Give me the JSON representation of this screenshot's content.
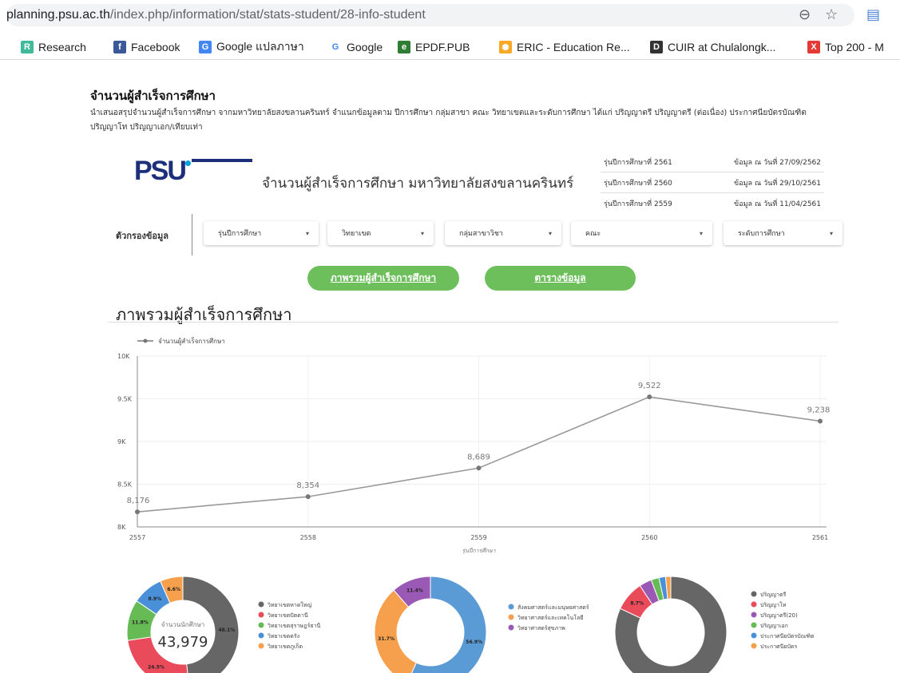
{
  "browser": {
    "url_domain": "planning.psu.ac.th",
    "url_path": "/index.php/information/stat/stats-student/28-info-student",
    "bookmarks": [
      {
        "label": "Research",
        "icon": "researchgate-icon",
        "color": "#40ba9b",
        "glyph": "R"
      },
      {
        "label": "Facebook",
        "icon": "facebook-icon",
        "color": "#3b5998",
        "glyph": "f"
      },
      {
        "label": "Google แปลภาษา",
        "icon": "google-translate-icon",
        "color": "#4285f4",
        "glyph": "G"
      },
      {
        "label": "Google",
        "icon": "google-icon",
        "color": "#ffffff",
        "glyph": "G"
      },
      {
        "label": "EPDF.PUB",
        "icon": "epdf-icon",
        "color": "#2e7d32",
        "glyph": "e"
      },
      {
        "label": "ERIC - Education Re...",
        "icon": "eric-icon",
        "color": "#f9a825",
        "glyph": "✺"
      },
      {
        "label": "CUIR at Chulalongk...",
        "icon": "cuir-icon",
        "color": "#333333",
        "glyph": "D"
      },
      {
        "label": "Top 200 - M",
        "icon": "top200-icon",
        "color": "#e53935",
        "glyph": "X"
      }
    ]
  },
  "page": {
    "title": "จำนวนผู้สำเร็จการศึกษา",
    "description": "นำเสนอสรุปจำนวนผู้สำเร็จการศึกษา จากมหาวิทยาลัยสงขลานครินทร์ จำแนกข้อมูลตาม ปีการศึกษา กลุ่มสาขา คณะ วิทยาเขตและระดับการศึกษา ได้แก่ ปริญญาตรี ปริญญาตรี (ต่อเนื่อง) ประกาศนียบัตรบัณฑิต ปริญญาโท ปริญญาเอก/เทียบเท่า"
  },
  "dashboard": {
    "logo_text": "PSU",
    "title": "จำนวนผู้สำเร็จการศึกษา มหาวิทยาลัยสงขลานครินทร์",
    "years": [
      {
        "label": "รุ่นปีการศึกษาที่ 2561",
        "date": "ข้อมูล ณ วันที่ 27/09/2562"
      },
      {
        "label": "รุ่นปีการศึกษาที่ 2560",
        "date": "ข้อมูล ณ วันที่ 29/10/2561"
      },
      {
        "label": "รุ่นปีการศึกษาที่ 2559",
        "date": "ข้อมูล ณ วันที่ 11/04/2561"
      }
    ],
    "filter_label": "ตัวกรองข้อมูล",
    "filters": [
      "รุ่นปีการศึกษา",
      "วิทยาเขต",
      "กลุ่มสาขาวิชา",
      "คณะ",
      "ระดับการศึกษา"
    ],
    "buttons": [
      "ภาพรวมผู้สำเร็จการศึกษา",
      "ตารางข้อมูล"
    ],
    "section_title": "ภาพรวมผู้สำเร็จการศึกษา",
    "line_color": "#999999",
    "accent_green": "#6dbf5c"
  },
  "chart_data": [
    {
      "type": "line",
      "legend": "จำนวนผู้สำเร็จการศึกษา",
      "xlabel": "รุ่นปีการศึกษา",
      "x": [
        "2557",
        "2558",
        "2559",
        "2560",
        "2561"
      ],
      "series": [
        {
          "name": "จำนวนผู้สำเร็จการศึกษา",
          "values": [
            8176,
            8354,
            8689,
            9522,
            9238
          ]
        }
      ],
      "data_labels": [
        "8,176",
        "8,354",
        "8,689",
        "9,522",
        "9,238"
      ],
      "ylim": [
        8000,
        10000
      ],
      "yticks": [
        "8K",
        "8.5K",
        "9K",
        "9.5K",
        "10K"
      ],
      "grid": true,
      "legend_position": "top-left"
    },
    {
      "type": "pie",
      "center_label": "จำนวนนักศึกษา",
      "center_value": "43,979",
      "labels": [
        "วิทยาเขตหาดใหญ่",
        "วิทยาเขตปัตตานี",
        "วิทยาเขตสุราษฎร์ธานี",
        "วิทยาเขตตรัง",
        "วิทยาเขตภูเก็ต"
      ],
      "values": [
        48.1,
        24.5,
        11.8,
        8.9,
        6.6
      ],
      "value_labels": [
        "48.1%",
        "24.5%",
        "11.8%",
        "8.9%",
        "6.6%"
      ],
      "colors": [
        "#666666",
        "#ea4b5a",
        "#66bb55",
        "#4a90d9",
        "#f6a04d"
      ]
    },
    {
      "type": "pie",
      "labels": [
        "สังคมศาสตร์และมนุษยศาสตร์",
        "วิทยาศาสตร์และเทคโนโลยี",
        "วิทยาศาสตร์สุขภาพ"
      ],
      "values": [
        56.9,
        31.7,
        11.4
      ],
      "value_labels": [
        "56.9%",
        "31.7%",
        "11.4%"
      ],
      "colors": [
        "#5b9bd5",
        "#f6a04d",
        "#9b59b6"
      ]
    },
    {
      "type": "pie",
      "labels": [
        "ปริญญาตรี",
        "ปริญญาโท",
        "ปริญญาตรี(20)",
        "ปริญญาเอก",
        "ประกาศนียบัตรบัณฑิต",
        "ประกาศนียบัตร"
      ],
      "values": [
        82.0,
        8.7,
        3.6,
        2.3,
        1.9,
        1.5
      ],
      "value_labels": [
        "",
        "8.7%",
        "",
        "",
        "",
        ""
      ],
      "colors": [
        "#666666",
        "#ea4b5a",
        "#9b59b6",
        "#66bb55",
        "#4a90d9",
        "#f6a04d"
      ]
    }
  ]
}
